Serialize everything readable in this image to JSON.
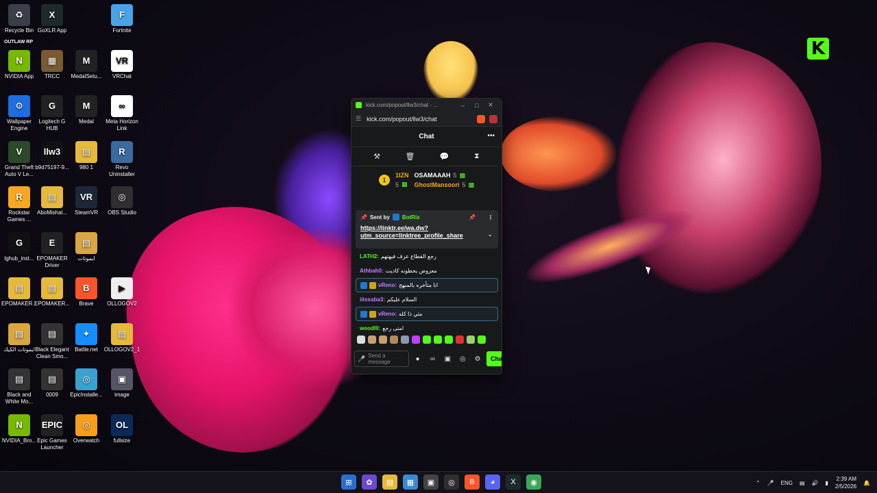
{
  "desktop": {
    "icons": [
      {
        "label": "Recycle Bin",
        "glyph": "♻",
        "bg": "#3a3f4a"
      },
      {
        "label": "GoXLR App",
        "glyph": "X",
        "bg": "#1d2a2a"
      },
      {
        "label": "Fortnite",
        "glyph": "F",
        "bg": "#4aa3e8"
      },
      {
        "label": "NVIDIA App",
        "glyph": "N",
        "bg": "#76b900"
      },
      {
        "label": "TRCC",
        "glyph": "▦",
        "bg": "#7a5a30"
      },
      {
        "label": "MedalSetu...",
        "glyph": "M",
        "bg": "#222"
      },
      {
        "label": "VRChat",
        "glyph": "VR",
        "bg": "#fff"
      },
      {
        "label": "Wallpaper Engine",
        "glyph": "⚙",
        "bg": "#1d6fe0"
      },
      {
        "label": "Logitech G HUB",
        "glyph": "G",
        "bg": "#222"
      },
      {
        "label": "Medal",
        "glyph": "M",
        "bg": "#222"
      },
      {
        "label": "Meta Horizon Link",
        "glyph": "∞",
        "bg": "#fff"
      },
      {
        "label": "Grand Theft Auto V Le...",
        "glyph": "V",
        "bg": "#2a4a2a"
      },
      {
        "label": "b9d75197-9...",
        "glyph": "llw3",
        "bg": "#111"
      },
      {
        "label": "980 1",
        "glyph": "▤",
        "bg": "#e6b93a"
      },
      {
        "label": "Revo Uninstaller",
        "glyph": "R",
        "bg": "#3a6aa0"
      },
      {
        "label": "Rockstar Games ...",
        "glyph": "R",
        "bg": "#f7a823"
      },
      {
        "label": "AboMishal...",
        "glyph": "▤",
        "bg": "#e6b93a"
      },
      {
        "label": "SteamVR",
        "glyph": "VR",
        "bg": "#1b2838"
      },
      {
        "label": "OBS Studio",
        "glyph": "◎",
        "bg": "#302e31"
      },
      {
        "label": "lghub_inst...",
        "glyph": "G",
        "bg": "#111"
      },
      {
        "label": "EPOMAKER Driver",
        "glyph": "E",
        "bg": "#222"
      },
      {
        "label": "ايموتات",
        "glyph": "▤",
        "bg": "#d9a640"
      },
      {
        "label": "EPOMAKER...",
        "glyph": "▤",
        "bg": "#e6b93a"
      },
      {
        "label": "EPOMAKER...",
        "glyph": "▤",
        "bg": "#e6b93a"
      },
      {
        "label": "Brave",
        "glyph": "B",
        "bg": "#fb542b"
      },
      {
        "label": "OLLOGOV2",
        "glyph": "▶",
        "bg": "#eee"
      },
      {
        "label": "ايموتات الكيك",
        "glyph": "▤",
        "bg": "#d9a640"
      },
      {
        "label": "Black Elegant Clean Smo...",
        "glyph": "▤",
        "bg": "#333"
      },
      {
        "label": "Battle.net",
        "glyph": "✦",
        "bg": "#148eff"
      },
      {
        "label": "OLLOGOV2_1",
        "glyph": "▤",
        "bg": "#e6b93a"
      },
      {
        "label": "Black and White Mo...",
        "glyph": "▤",
        "bg": "#333"
      },
      {
        "label": "0009",
        "glyph": "▤",
        "bg": "#333"
      },
      {
        "label": "EpicInstalle...",
        "glyph": "◎",
        "bg": "#3aa0d0"
      },
      {
        "label": "image",
        "glyph": "▣",
        "bg": "#556"
      },
      {
        "label": "NVIDIA_Bro...",
        "glyph": "N",
        "bg": "#76b900"
      },
      {
        "label": "Epic Games Launcher",
        "glyph": "EPIC",
        "bg": "#222"
      },
      {
        "label": "Overwatch",
        "glyph": "◎",
        "bg": "#f99e1a"
      },
      {
        "label": "fullsize",
        "glyph": "OL",
        "bg": "#0a2a5a"
      }
    ],
    "outlaw_label": "OUTLAW RP",
    "kick_logo": "K"
  },
  "browser": {
    "tab_title": "kick.com/popout/llw3/chat - ...",
    "url": "kick.com/popout/llw3/chat",
    "controls": {
      "minimize": "–",
      "maximize": "□",
      "close": "✕"
    }
  },
  "chat": {
    "title": "Chat",
    "more": "•••",
    "mod_tools": [
      "⚒",
      "🗑",
      "💬",
      "⧗"
    ],
    "top_gifters": [
      {
        "name": "1IZN",
        "count": "5"
      },
      {
        "name": "OSAMAAAH",
        "count": "5"
      },
      {
        "name": "GhostMansoori",
        "count": "5"
      }
    ],
    "crown_rank": "1",
    "pinned": {
      "sent_by_label": "Sent by",
      "sender": "BotRix",
      "link": "https://linktr.ee/wa.dw?utm_source=linktree_profile_share"
    },
    "messages": [
      {
        "user": "LATH2",
        "text": "رجع القطاع عرف فيهتهم",
        "color": "#53fc18",
        "highlight": false,
        "badges": false
      },
      {
        "user": "Athbah0",
        "text": "معزوض يحطونه كاديت",
        "color": "#c080ff",
        "highlight": false,
        "badges": false
      },
      {
        "user": "vReno",
        "text": "انا متأخره بالمنهج",
        "color": "#c080ff",
        "highlight": true,
        "badges": true
      },
      {
        "user": "iitssaba3",
        "text": "السلام عليكم",
        "color": "#c080ff",
        "highlight": false,
        "badges": false
      },
      {
        "user": "vReno",
        "text": "مثي ذا كله",
        "color": "#c080ff",
        "highlight": true,
        "badges": true
      },
      {
        "user": "woodlll",
        "text": "امتى رجع",
        "color": "#53fc18",
        "highlight": false,
        "badges": false
      }
    ],
    "emote_colors": [
      "#ddd",
      "#c9a070",
      "#c9a070",
      "#b08a60",
      "#8a9ab0",
      "#c040ff",
      "#53fc18",
      "#53fc18",
      "#53fc18",
      "#e03030",
      "#9ad070",
      "#53fc18"
    ],
    "input_placeholder": "Send a message",
    "send_label": "Chat"
  },
  "taskbar": {
    "apps": [
      {
        "name": "start",
        "glyph": "⊞",
        "bg": "#2a6fd0"
      },
      {
        "name": "copilot",
        "glyph": "✿",
        "bg": "#6a4ad0"
      },
      {
        "name": "file-explorer",
        "glyph": "▤",
        "bg": "#e6b93a"
      },
      {
        "name": "store",
        "glyph": "▦",
        "bg": "#3a8ad0"
      },
      {
        "name": "app",
        "glyph": "▣",
        "bg": "#444"
      },
      {
        "name": "obs",
        "glyph": "◎",
        "bg": "#302e31"
      },
      {
        "name": "brave",
        "glyph": "B",
        "bg": "#fb542b"
      },
      {
        "name": "discord",
        "glyph": "◕",
        "bg": "#5865f2"
      },
      {
        "name": "goxlr",
        "glyph": "X",
        "bg": "#1d2a2a"
      },
      {
        "name": "chrome",
        "glyph": "◉",
        "bg": "#3aa757"
      }
    ],
    "language": "ENG",
    "time": "2:39 AM",
    "date": "2/5/2026"
  }
}
